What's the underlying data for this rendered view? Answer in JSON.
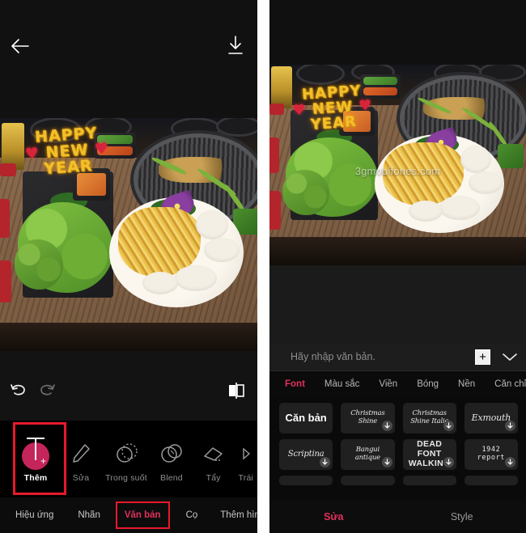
{
  "left_panel": {
    "topbar": {
      "back_icon": "arrow-left-icon",
      "download_icon": "download-icon"
    },
    "photo": {
      "overlay_text_lines": [
        "HAPPY",
        "NEW",
        "YEAR"
      ],
      "description": "korean-bbq-meal-photo"
    },
    "history_bar": {
      "undo_icon": "undo-icon",
      "redo_icon": "redo-icon",
      "layers_icon": "layers-icon"
    },
    "tools": [
      {
        "label": "Thêm",
        "icon": "add-text-icon",
        "active": true
      },
      {
        "label": "Sửa",
        "icon": "pencil-icon",
        "active": false
      },
      {
        "label": "Trong suốt",
        "icon": "opacity-icon",
        "active": false
      },
      {
        "label": "Blend",
        "icon": "blend-icon",
        "active": false
      },
      {
        "label": "Tẩy",
        "icon": "eraser-icon",
        "active": false
      },
      {
        "label": "Trái",
        "icon": "play-triangle-icon",
        "active": false
      }
    ],
    "nav": [
      {
        "label": "Hiệu ứng",
        "active": false
      },
      {
        "label": "Nhãn",
        "active": false
      },
      {
        "label": "Văn bản",
        "active": true
      },
      {
        "label": "Cọ",
        "active": false
      },
      {
        "label": "Thêm hình ảnh",
        "active": false
      }
    ]
  },
  "right_panel": {
    "photo": {
      "overlay_text_lines": [
        "HAPPY",
        "NEW",
        "YEAR"
      ],
      "watermark": "3gmobifones.com",
      "description": "korean-bbq-meal-photo"
    },
    "text_input": {
      "placeholder": "Hãy nhập văn bản.",
      "value": "",
      "add_button_label": "+",
      "collapse_icon": "chevron-down-icon"
    },
    "tabs": [
      {
        "label": "Font",
        "active": true
      },
      {
        "label": "Màu sắc",
        "active": false
      },
      {
        "label": "Viền",
        "active": false
      },
      {
        "label": "Bóng",
        "active": false
      },
      {
        "label": "Nền",
        "active": false
      },
      {
        "label": "Căn chỉnh",
        "active": false
      }
    ],
    "fonts": [
      [
        {
          "name": "Căn bản",
          "style": "basic",
          "downloadable": false
        },
        {
          "name": "Christmas Shine",
          "style": "script",
          "downloadable": true
        },
        {
          "name": "Christmas Shine Italic",
          "style": "script",
          "downloadable": true
        },
        {
          "name": "Exmouth",
          "style": "script",
          "downloadable": true
        }
      ],
      [
        {
          "name": "Scriptina",
          "style": "script",
          "downloadable": true
        },
        {
          "name": "Bangui antique",
          "style": "script",
          "downloadable": true
        },
        {
          "name": "DEAD FONT WALKING",
          "style": "bold",
          "downloadable": true
        },
        {
          "name": "1942 report",
          "style": "mono",
          "downloadable": true
        }
      ]
    ],
    "bottom_tabs": [
      {
        "label": "Sửa",
        "active": true
      },
      {
        "label": "Style",
        "active": false
      }
    ]
  },
  "colors": {
    "accent_pink": "#e0315c",
    "highlight_red": "#e8192c",
    "tool_circle": "#c4255a",
    "panel_bg": "#0a0a0a",
    "muted_text": "#8f8f8f"
  }
}
